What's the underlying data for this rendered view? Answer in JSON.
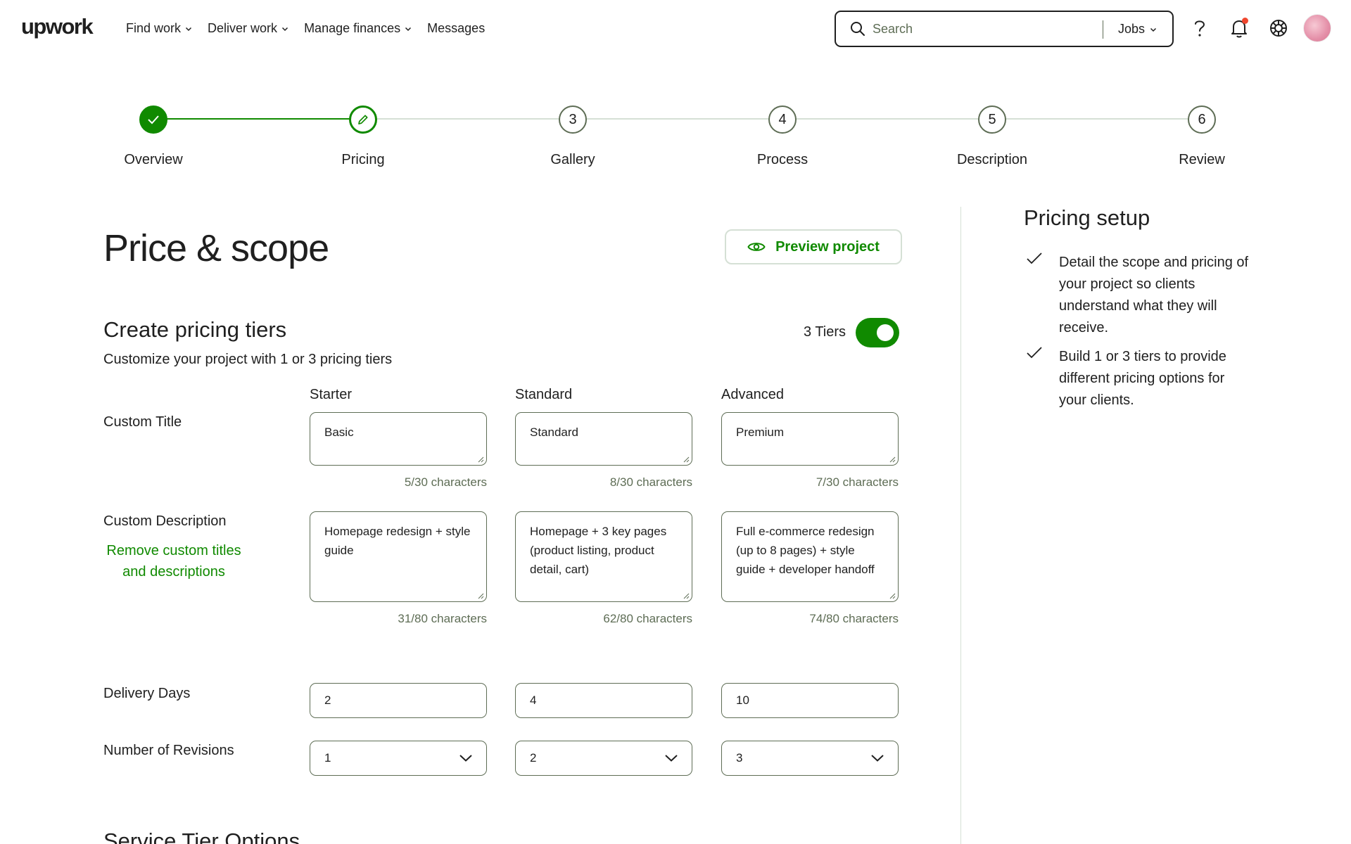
{
  "header": {
    "logo": "upwork",
    "nav": [
      {
        "label": "Find work",
        "has_dropdown": true
      },
      {
        "label": "Deliver work",
        "has_dropdown": true
      },
      {
        "label": "Manage finances",
        "has_dropdown": true
      },
      {
        "label": "Messages",
        "has_dropdown": false
      }
    ],
    "search": {
      "placeholder": "Search",
      "scope": "Jobs"
    },
    "icons": [
      "help-icon",
      "bell-icon",
      "apps-icon"
    ],
    "notification_dot_color": "#f0472f"
  },
  "stepper": {
    "steps": [
      {
        "label": "Overview",
        "state": "done",
        "number": ""
      },
      {
        "label": "Pricing",
        "state": "current",
        "number": ""
      },
      {
        "label": "Gallery",
        "state": "upcoming",
        "number": "3"
      },
      {
        "label": "Process",
        "state": "upcoming",
        "number": "4"
      },
      {
        "label": "Description",
        "state": "upcoming",
        "number": "5"
      },
      {
        "label": "Review",
        "state": "upcoming",
        "number": "6"
      }
    ]
  },
  "main": {
    "title": "Price & scope",
    "preview_button": "Preview project",
    "tiers_section": {
      "title": "Create pricing tiers",
      "subtitle": "Customize your project with 1 or 3 pricing tiers",
      "toggle_label": "3 Tiers",
      "toggle_on": true,
      "columns": [
        "Starter",
        "Standard",
        "Advanced"
      ],
      "custom_title": {
        "label": "Custom Title",
        "values": [
          "Basic",
          "Standard",
          "Premium"
        ],
        "counters": [
          "5/30 characters",
          "8/30 characters",
          "7/30 characters"
        ]
      },
      "custom_description": {
        "label": "Custom Description",
        "remove_link": "Remove custom titles and descriptions",
        "values": [
          "Homepage redesign + style guide",
          "Homepage + 3 key pages (product listing, product detail, cart)",
          "Full e-commerce redesign (up to 8 pages) + style guide + developer handoff"
        ],
        "counters": [
          "31/80 characters",
          "62/80 characters",
          "74/80 characters"
        ]
      },
      "delivery_days": {
        "label": "Delivery Days",
        "values": [
          "2",
          "4",
          "10"
        ]
      },
      "revisions": {
        "label": "Number of Revisions",
        "values": [
          "1",
          "2",
          "3"
        ]
      }
    },
    "next_section_title": "Service Tier Options"
  },
  "sidebar": {
    "title": "Pricing setup",
    "tips": [
      "Detail the scope and pricing of your project so clients understand what they will receive.",
      "Build 1 or 3 tiers to provide different pricing options for your clients."
    ]
  },
  "colors": {
    "brand_green": "#108a00",
    "border": "#5e6d55",
    "light_border": "#d5e0d5"
  }
}
